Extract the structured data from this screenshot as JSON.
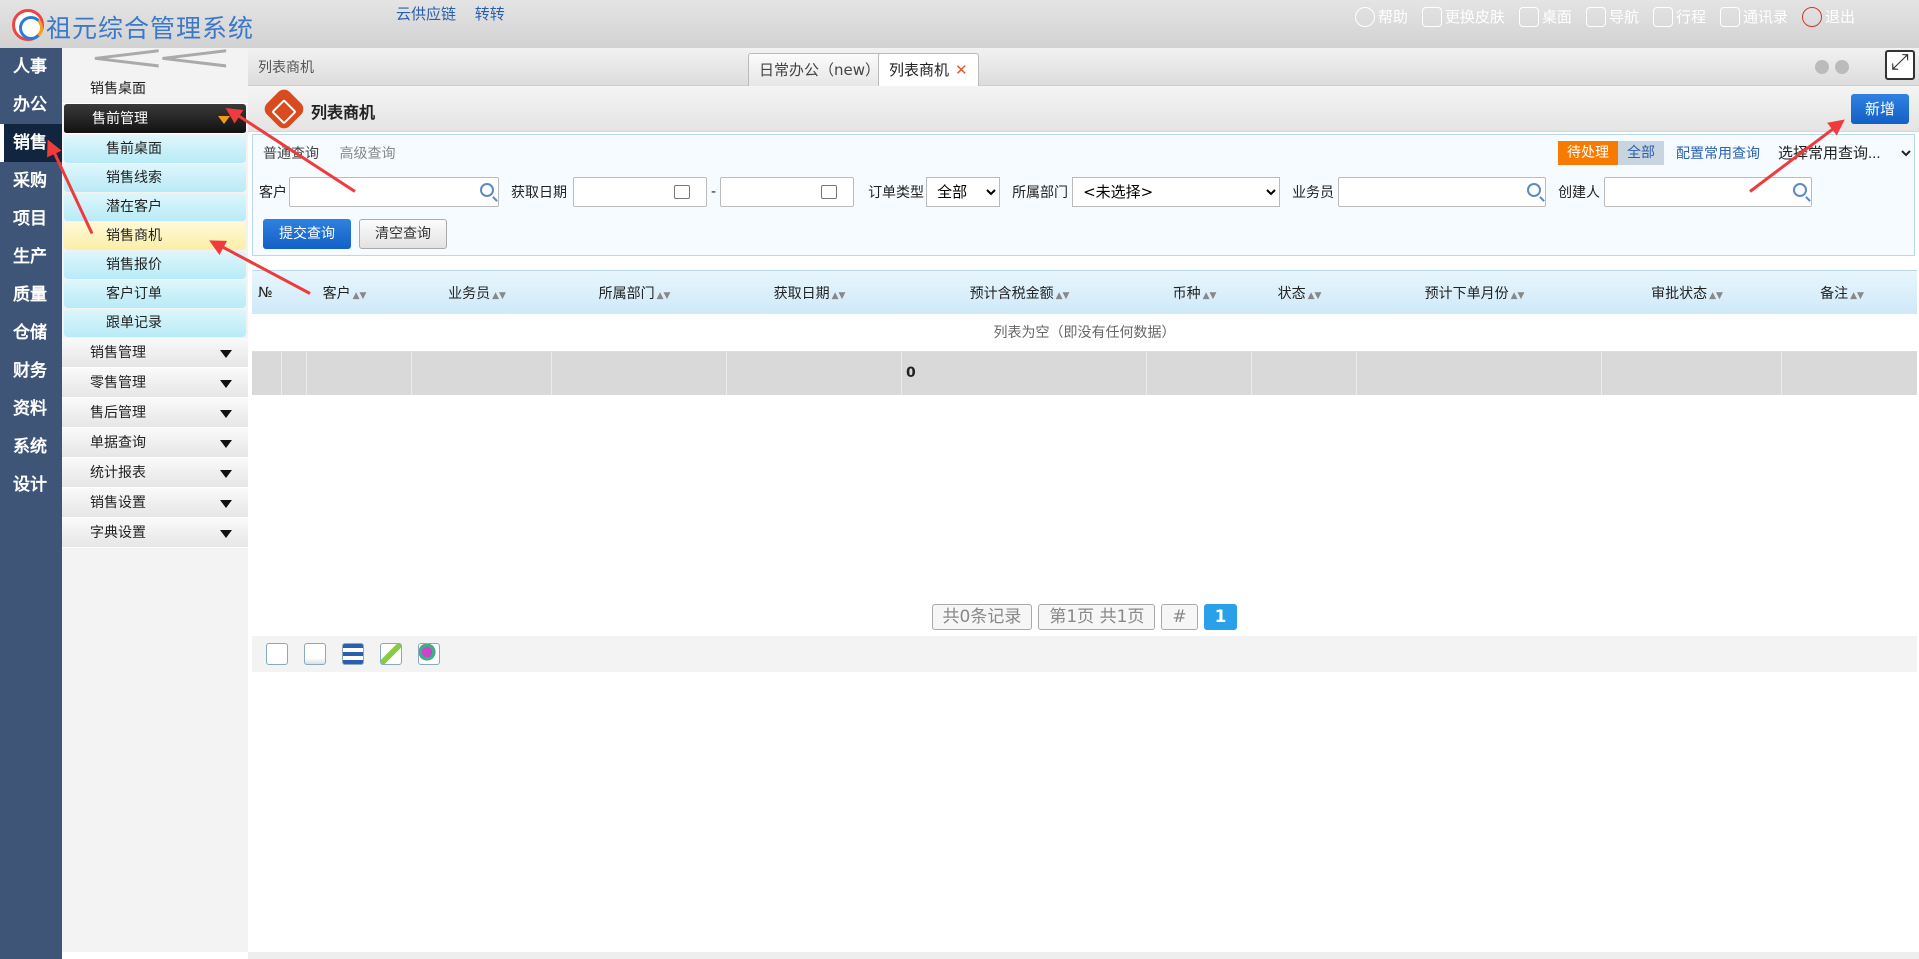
{
  "app": {
    "title": "祖元综合管理系统",
    "links": [
      "云供应链",
      "转转"
    ]
  },
  "toolbar": {
    "help": "帮助",
    "skin": "更换皮肤",
    "desktop": "桌面",
    "nav": "导航",
    "schedule": "行程",
    "contacts": "通讯录",
    "logout": "退出"
  },
  "leftnav": [
    "人事",
    "办公",
    "销售",
    "采购",
    "项目",
    "生产",
    "质量",
    "仓储",
    "财务",
    "资料",
    "系统",
    "设计"
  ],
  "sidebar": {
    "top_item": "销售桌面",
    "group_presale": "售前管理",
    "sub": [
      "售前桌面",
      "销售线索",
      "潜在客户",
      "销售商机",
      "销售报价",
      "客户订单",
      "跟单记录"
    ],
    "groups": [
      "销售管理",
      "零售管理",
      "售后管理",
      "单据查询",
      "统计报表",
      "销售设置",
      "字典设置"
    ]
  },
  "tabs": {
    "crumb": "列表商机",
    "tab1": "日常办公（new）",
    "tab2": "列表商机"
  },
  "page": {
    "title": "列表商机",
    "new_button": "新增"
  },
  "query": {
    "normal": "普通查询",
    "advanced": "高级查询",
    "pending": "待处理",
    "all": "全部",
    "config": "配置常用查询",
    "common": "选择常用查询...",
    "customer": "客户",
    "date": "获取日期",
    "dash": "-",
    "order_type": "订单类型",
    "order_type_value": "全部",
    "dept": "所属部门",
    "dept_value": "<未选择>",
    "salesman": "业务员",
    "creator": "创建人",
    "submit": "提交查询",
    "clear": "清空查询"
  },
  "grid": {
    "columns": [
      "№",
      "客户",
      "业务员",
      "所属部门",
      "获取日期",
      "预计含税金额",
      "币种",
      "状态",
      "预计下单月份",
      "审批状态",
      "备注"
    ],
    "empty": "列表为空（即没有任何数据）",
    "total": "0"
  },
  "pager": {
    "records": "共0条记录",
    "pages": "第1页 共1页",
    "hash": "#",
    "current": "1"
  }
}
